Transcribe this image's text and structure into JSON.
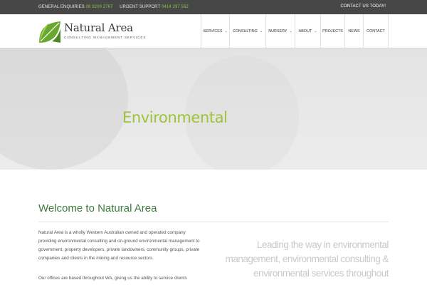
{
  "topbar": {
    "general_label": "GENERAL ENQUIRIES",
    "general_phone": "08 9209 2767",
    "urgent_label": "URGENT SUPPORT",
    "urgent_phone": "0414 297 562",
    "contact_cta": "CONTACT US TODAY!"
  },
  "logo": {
    "brand": "Natural Area",
    "tagline": "CONSULTING MANAGEMENT SERVICES"
  },
  "nav": {
    "items": [
      {
        "label": "SERVICES",
        "dropdown": true
      },
      {
        "label": "CONSULTING",
        "dropdown": true
      },
      {
        "label": "NURSERY",
        "dropdown": true
      },
      {
        "label": "ABOUT",
        "dropdown": true
      },
      {
        "label": "PROJECTS",
        "dropdown": false
      },
      {
        "label": "NEWS",
        "dropdown": false
      },
      {
        "label": "CONTACT",
        "dropdown": false
      }
    ]
  },
  "hero": {
    "title": "Environmental"
  },
  "main": {
    "heading": "Welcome to Natural Area",
    "paragraph1": "Natural Area is a wholly Western Australian owned and operated company providing environmental consulting and on-ground environmental management to government, property developers, private landowners, community groups, private companies and clients in the mining and resource sectors.",
    "paragraph2": "Our offices are based throughout WA, giving us the ability to service clients",
    "tagline": "Leading the way in environmental management, environmental consulting & environmental services throughout"
  },
  "colors": {
    "accent_green": "#8dc63f",
    "hero_title": "#9dc23a",
    "heading_green": "#3d7a3c",
    "topbar_bg": "#474747"
  }
}
